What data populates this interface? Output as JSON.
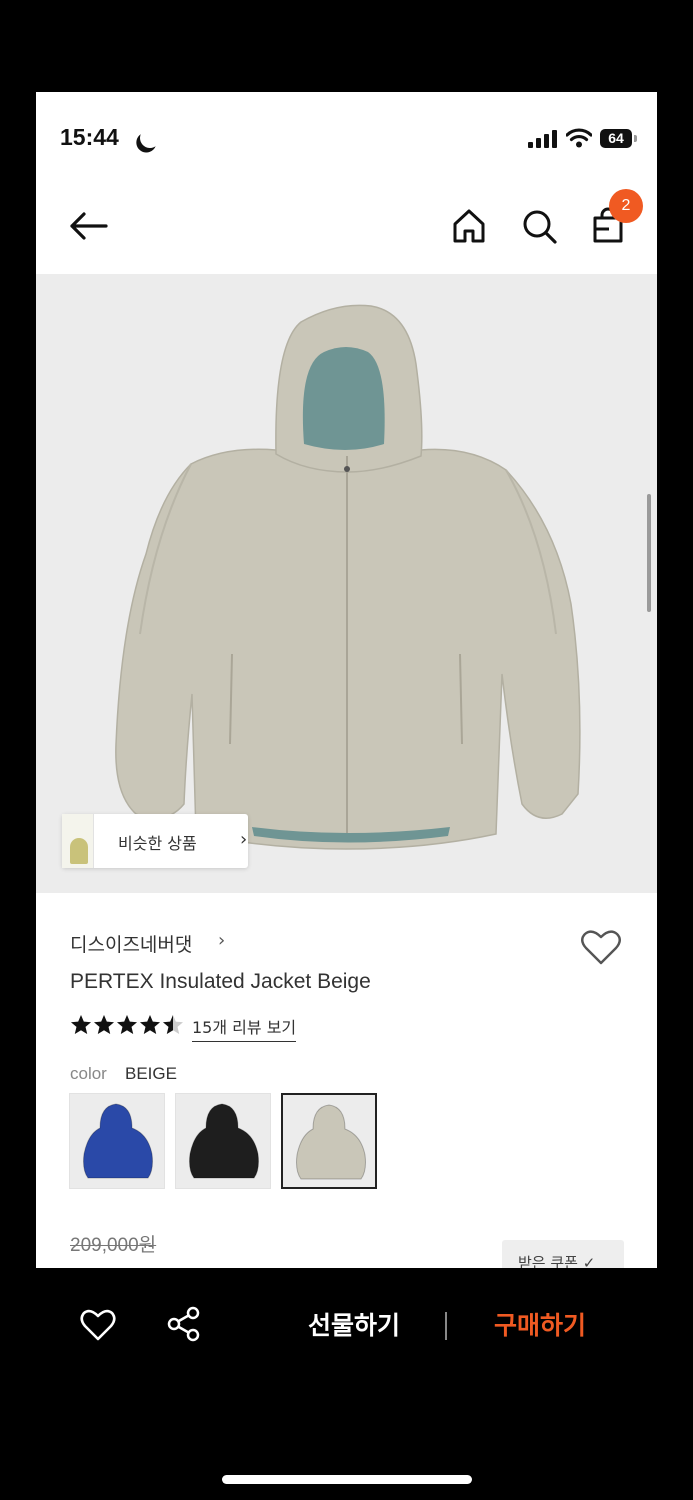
{
  "status_bar": {
    "time": "15:44",
    "battery": "64"
  },
  "header": {
    "cart_count": "2"
  },
  "product_image": {
    "similar_products_label": "비슷한 상품",
    "similar_chevron": "›"
  },
  "product": {
    "brand": "디스이즈네버댓",
    "brand_chevron": "›",
    "name": "PERTEX Insulated Jacket Beige",
    "rating_stars": 4.5,
    "review_link": "15개 리뷰 보기",
    "color_label": "color",
    "color_value": "BEIGE",
    "swatches": [
      {
        "color": "#2a49a8",
        "selected": false
      },
      {
        "color": "#1e1e1e",
        "selected": false
      },
      {
        "color": "#c9c6b8",
        "selected": true
      }
    ],
    "original_price": "209,000원",
    "coupon_label": "받은 쿠폰 ✓"
  },
  "bottom_bar": {
    "gift_label": "선물하기",
    "buy_label": "구매하기"
  },
  "colors": {
    "accent": "#f05a22",
    "image_bg": "#ececec",
    "jacket": "#c9c6b8"
  }
}
